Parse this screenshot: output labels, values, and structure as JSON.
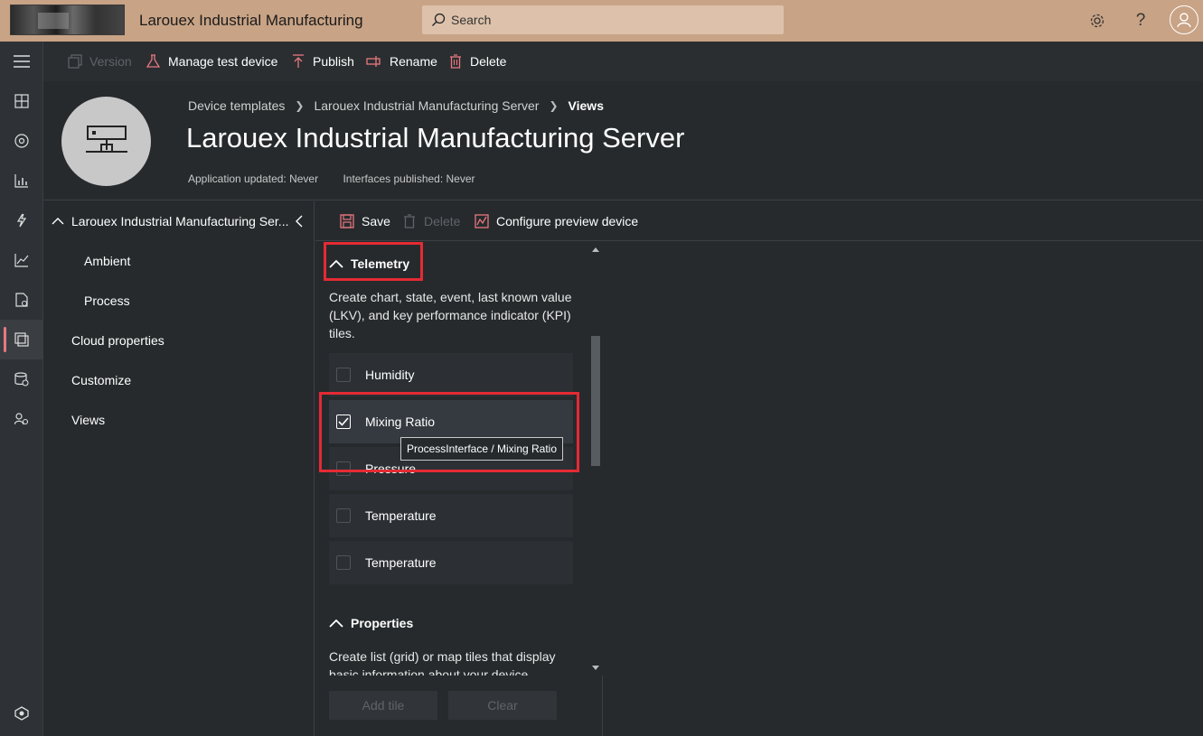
{
  "app": {
    "title": "Larouex Industrial Manufacturing",
    "search_placeholder": "Search"
  },
  "topbar": {
    "icons": [
      "settings-icon",
      "help-icon",
      "user-icon"
    ],
    "help_glyph": "?"
  },
  "rail": {
    "items": [
      "menu-icon",
      "dashboard-icon",
      "devices-icon",
      "analytics-icon",
      "rules-icon",
      "charts-icon",
      "jobs-icon",
      "device-templates-icon",
      "data-export-icon",
      "administration-icon",
      "iot-central-icon"
    ],
    "active_index": 7,
    "accent_color": "#e8787f"
  },
  "commands": {
    "version": "Version",
    "manage_test_device": "Manage test device",
    "publish": "Publish",
    "rename": "Rename",
    "delete": "Delete"
  },
  "header": {
    "breadcrumb": [
      "Device templates",
      "Larouex Industrial Manufacturing Server",
      "Views"
    ],
    "title": "Larouex Industrial Manufacturing Server",
    "app_updated": "Application updated: Never",
    "interfaces_published": "Interfaces published: Never"
  },
  "tree": {
    "root_label": "Larouex Industrial Manufacturing Ser...",
    "children": [
      "Ambient",
      "Process"
    ],
    "items": [
      "Cloud properties",
      "Customize",
      "Views"
    ]
  },
  "editor_toolbar": {
    "save": "Save",
    "delete": "Delete",
    "configure_preview": "Configure preview device"
  },
  "library": {
    "telemetry": {
      "title": "Telemetry",
      "description": "Create chart, state, event, last known value (LKV), and key performance indicator (KPI) tiles.",
      "items": [
        {
          "label": "Humidity",
          "checked": false
        },
        {
          "label": "Mixing Ratio",
          "checked": true
        },
        {
          "label": "Pressure",
          "checked": false
        },
        {
          "label": "Temperature",
          "checked": false
        },
        {
          "label": "Temperature",
          "checked": false
        }
      ],
      "tooltip": "ProcessInterface / Mixing Ratio"
    },
    "properties": {
      "title": "Properties",
      "description": "Create list (grid) or map tiles that display basic information about your device."
    },
    "buttons": {
      "add_tile": "Add tile",
      "clear": "Clear"
    }
  },
  "colors": {
    "topbar": "#c8a385",
    "background": "#262a2d",
    "accent": "#e8787f",
    "highlight": "#e52a34"
  }
}
